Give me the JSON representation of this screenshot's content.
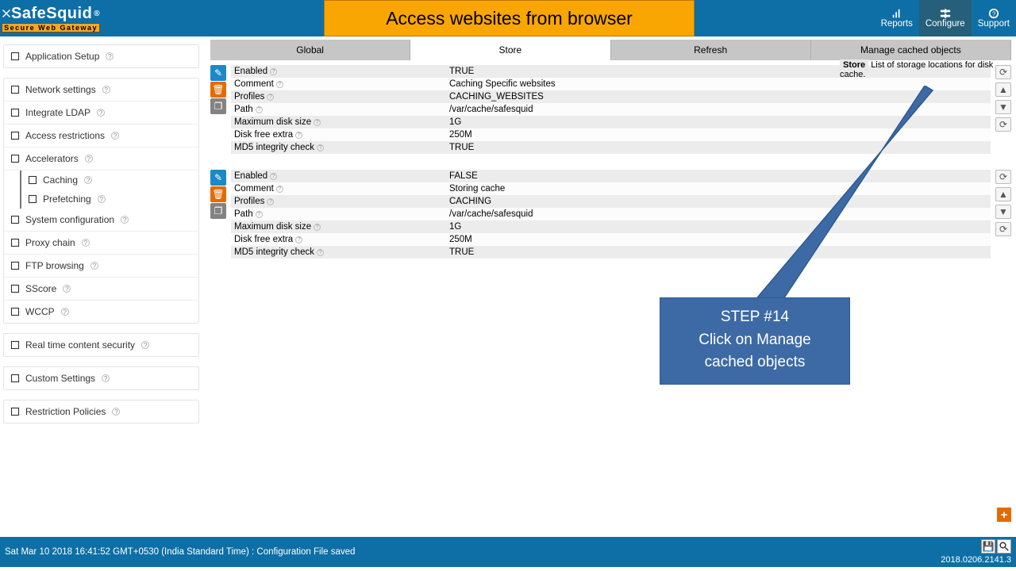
{
  "header": {
    "logo_name": "SafeSquid",
    "logo_reg": "®",
    "logo_sub": "Secure Web Gateway",
    "banner": "Access websites from browser",
    "actions": [
      {
        "label": "Reports",
        "active": false
      },
      {
        "label": "Configure",
        "active": true
      },
      {
        "label": "Support",
        "active": false
      }
    ]
  },
  "sidebar": [
    {
      "type": "group",
      "items": [
        {
          "label": "Application Setup",
          "icon": "briefcase"
        }
      ]
    },
    {
      "type": "group",
      "items": [
        {
          "label": "Network settings",
          "icon": "globe"
        },
        {
          "label": "Integrate LDAP",
          "icon": "list"
        },
        {
          "label": "Access restrictions",
          "icon": "check-square"
        },
        {
          "label": "Accelerators",
          "icon": "dashboard",
          "expanded": true,
          "children": [
            {
              "label": "Caching",
              "icon": "box"
            },
            {
              "label": "Prefetching",
              "icon": "magnet"
            }
          ]
        },
        {
          "label": "System configuration",
          "icon": "puzzle"
        },
        {
          "label": "Proxy chain",
          "icon": "forward"
        },
        {
          "label": "FTP browsing",
          "icon": "paperclip"
        },
        {
          "label": "SScore",
          "icon": "shield-check"
        },
        {
          "label": "WCCP",
          "icon": "stack"
        }
      ]
    },
    {
      "type": "group",
      "items": [
        {
          "label": "Real time content security",
          "icon": "bug"
        }
      ]
    },
    {
      "type": "group",
      "items": [
        {
          "label": "Custom Settings",
          "icon": "sliders"
        }
      ]
    },
    {
      "type": "group",
      "items": [
        {
          "label": "Restriction Policies",
          "icon": "shield"
        }
      ]
    }
  ],
  "tabs": [
    "Global",
    "Store",
    "Refresh",
    "Manage cached objects"
  ],
  "active_tab": 1,
  "info": {
    "title": "Store",
    "text": "List of storage locations for disk cache."
  },
  "blocks": [
    {
      "rows": [
        {
          "k": "Enabled",
          "v": "TRUE"
        },
        {
          "k": "Comment",
          "v": "Caching Specific websites"
        },
        {
          "k": "Profiles",
          "v": "CACHING_WEBSITES"
        },
        {
          "k": "Path",
          "v": "/var/cache/safesquid"
        },
        {
          "k": "Maximum disk size",
          "v": "1G"
        },
        {
          "k": "Disk free extra",
          "v": "250M"
        },
        {
          "k": "MD5 integrity check",
          "v": "TRUE"
        }
      ]
    },
    {
      "rows": [
        {
          "k": "Enabled",
          "v": "FALSE"
        },
        {
          "k": "Comment",
          "v": "Storing cache"
        },
        {
          "k": "Profiles",
          "v": "CACHING"
        },
        {
          "k": "Path",
          "v": "/var/cache/safesquid"
        },
        {
          "k": "Maximum disk size",
          "v": "1G"
        },
        {
          "k": "Disk free extra",
          "v": "250M"
        },
        {
          "k": "MD5 integrity check",
          "v": "TRUE"
        }
      ]
    }
  ],
  "callout": {
    "step": "STEP #14",
    "line1": "Click on Manage",
    "line2": "cached objects"
  },
  "footer": {
    "status": "Sat Mar 10 2018 16:41:52 GMT+0530 (India Standard Time) : Configuration File saved",
    "version": "2018.0206.2141.3"
  },
  "side_buttons": [
    "⟳",
    "▲",
    "▼",
    "⟳"
  ]
}
